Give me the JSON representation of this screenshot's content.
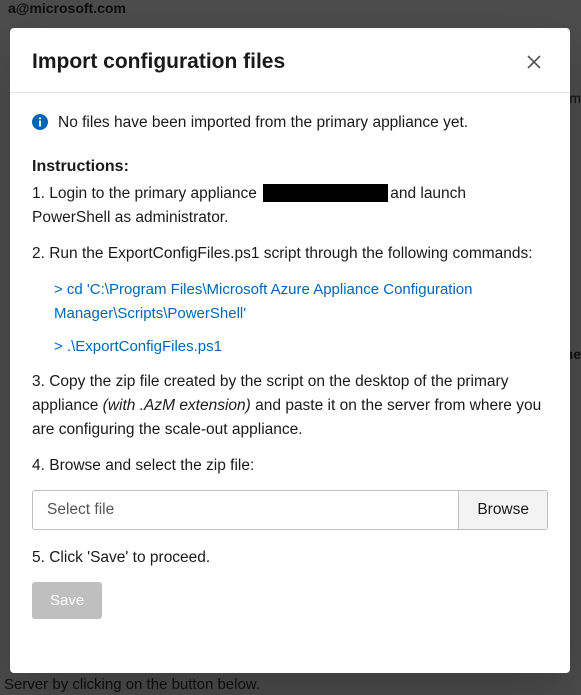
{
  "background": {
    "top_fragment": "a@microsoft.com",
    "right_om": "om",
    "right_ne": "ne",
    "bottom_fragment": "Server by clicking on the button below."
  },
  "modal": {
    "title": "Import configuration files",
    "close_icon_title": "Close",
    "info_text": "No files have been imported from the primary appliance yet.",
    "instructions_label": "Instructions:",
    "step1_prefix": "1. Login to the primary appliance ",
    "step1_suffix": "and launch PowerShell as administrator.",
    "step2": "2. Run the ExportConfigFiles.ps1 script through the following commands:",
    "cmd1": "> cd 'C:\\Program Files\\Microsoft Azure Appliance Configuration Manager\\Scripts\\PowerShell'",
    "cmd2": "> .\\ExportConfigFiles.ps1",
    "step3_prefix": "3. Copy the zip file created by the script on the desktop of the primary appliance ",
    "step3_italic": "(with .AzM extension)",
    "step3_suffix": " and paste it on the server from where you are configuring the scale-out appliance.",
    "step4": "4. Browse and select the zip file:",
    "file_placeholder": "Select file",
    "file_value": "",
    "browse_label": "Browse",
    "step5": "5. Click 'Save' to proceed.",
    "save_label": "Save"
  },
  "colors": {
    "link": "#0067b8",
    "info_icon": "#0067b8"
  }
}
